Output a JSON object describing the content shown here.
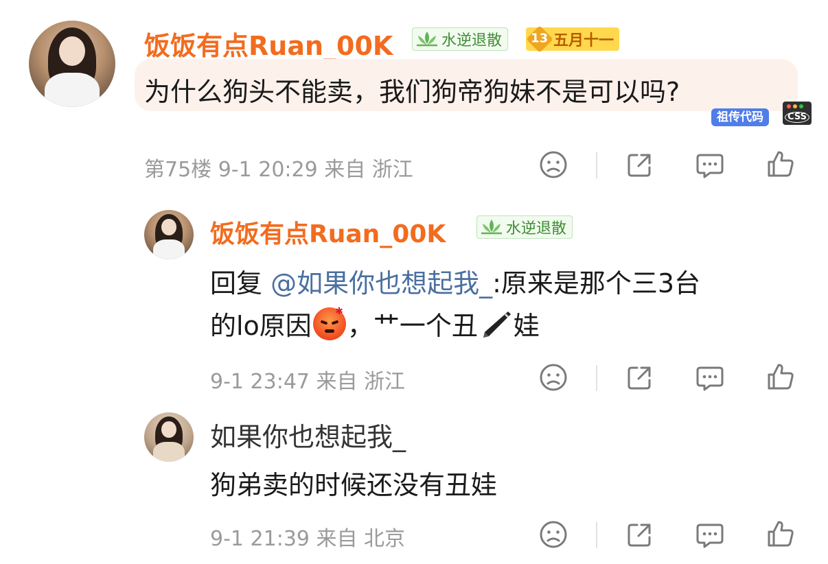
{
  "comment": {
    "username": "饭饭有点Ruan_00K",
    "badge_green": "水逆退散",
    "badge_gold_level": "13",
    "badge_gold_text": "五月十一",
    "text": "为什么狗头不能卖，我们狗帝狗妹不是可以吗?",
    "chip_blue": "祖传代码",
    "chip_css": "CSS",
    "meta": "第75楼  9-1 20:29  来自 浙江"
  },
  "reply1": {
    "username": "饭饭有点Ruan_00K",
    "badge_green": "水逆退散",
    "line1_prefix": "回复 ",
    "mention": "@如果你也想起我_",
    "line1_suffix": ":原来是那个三3台",
    "line2_prefix": "的lo原因",
    "line2_mid": "，艹一个丑",
    "line2_suffix": "娃",
    "meta": "9-1 23:47  来自 浙江"
  },
  "reply2": {
    "username": "如果你也想起我_",
    "text": "狗弟卖的时候还没有丑娃",
    "meta": "9-1 21:39  来自 北京"
  },
  "icons": [
    "dislike-icon",
    "share-icon",
    "comment-icon",
    "like-icon"
  ],
  "colors": {
    "username": "#f26c1f",
    "mention": "#4a6fa0",
    "meta": "#9a9a9a",
    "bubble": "#fdf1ec"
  }
}
